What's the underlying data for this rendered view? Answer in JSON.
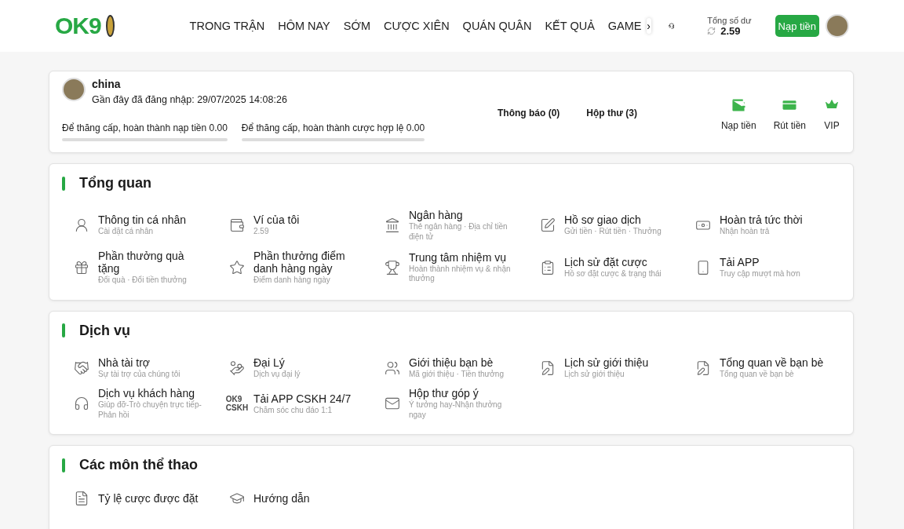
{
  "header": {
    "brand": "OK9",
    "nav": [
      {
        "label": "TRONG TRẬN"
      },
      {
        "label": "HÔM NAY"
      },
      {
        "label": "SỚM"
      },
      {
        "label": "CƯỢC XIÊN"
      },
      {
        "label": "QUÁN QUÂN"
      },
      {
        "label": "KẾT QUẢ"
      },
      {
        "label": "GAME"
      }
    ],
    "nav_more": "›",
    "balance_label": "Tổng số dư",
    "balance": "2.59",
    "deposit_button": "Nạp tiền"
  },
  "profile": {
    "name": "china",
    "last_login": "Gần đây đã đăng nhập: 29/07/2025 14:08:26",
    "progress": [
      {
        "label": "Để thăng cấp, hoàn thành nạp tiền 0.00",
        "level": 0
      },
      {
        "label": "Để thăng cấp, hoàn thành cược hợp lệ 0.00",
        "level": 0
      }
    ],
    "links": [
      "Thông báo (0)",
      "Hộp thư (3)"
    ],
    "actions": [
      "Nạp tiền",
      "Rút tiền",
      "VIP"
    ]
  },
  "sections": [
    {
      "title": "Tổng quan",
      "items": [
        {
          "kind": "icon",
          "title": "Thông tin cá nhân",
          "subtitle": "Cài đặt cá nhân"
        },
        {
          "kind": "icon",
          "title": "Ví của tôi",
          "subtitle": "2.59"
        },
        {
          "kind": "icon",
          "title": "Ngân hàng",
          "subtitle": "Thẻ ngân hàng · Địa chỉ tiền điện tử"
        },
        {
          "kind": "icon",
          "title": "Hồ sơ giao dịch",
          "subtitle": "Gửi tiền · Rút tiền · Thưởng"
        },
        {
          "kind": "icon",
          "title": "Hoàn trả tức thời",
          "subtitle": "Nhận hoàn trả"
        },
        {
          "kind": "icon",
          "title": "Phần thưởng quà tặng",
          "subtitle": "Đổi quà · Đổi tiền thưởng"
        },
        {
          "kind": "icon",
          "title": "Phần thưởng điểm danh hàng ngày",
          "subtitle": "Điểm danh hàng ngày"
        },
        {
          "kind": "icon",
          "title": "Trung tâm nhiệm vụ",
          "subtitle": "Hoàn thành nhiệm vụ & nhận thưởng"
        },
        {
          "kind": "icon",
          "title": "Lịch sử đặt cược",
          "subtitle": "Hồ sơ đặt cược & trạng thái"
        },
        {
          "kind": "icon",
          "title": "Tải APP",
          "subtitle": "Truy cập mượt mà hơn"
        }
      ]
    },
    {
      "title": "Dịch vụ",
      "items": [
        {
          "kind": "icon",
          "title": "Nhà tài trợ",
          "subtitle": "Sự tài trợ của chúng tôi"
        },
        {
          "kind": "icon",
          "title": "Đại Lý",
          "subtitle": "Dịch vụ đại lý"
        },
        {
          "kind": "icon",
          "title": "Giới thiệu bạn bè",
          "subtitle": "Mã giới thiệu · Tiền thưởng"
        },
        {
          "kind": "icon",
          "title": "Lịch sử giới thiệu",
          "subtitle": "Lịch sử giới thiệu"
        },
        {
          "kind": "icon",
          "title": "Tổng quan về bạn bè",
          "subtitle": "Tổng quan về bạn bè"
        },
        {
          "kind": "icon",
          "title": "Dịch vụ khách hàng",
          "subtitle": "Giúp đỡ-Trò chuyện trực tiếp-Phản hồi"
        },
        {
          "kind": "text-logo",
          "logo_lines": [
            "OK9",
            "CSKH"
          ],
          "title": "Tải APP CSKH 24/7",
          "subtitle": "Chăm sóc chu đáo 1:1"
        },
        {
          "kind": "icon",
          "title": "Hộp thư góp ý",
          "subtitle": "Ý tưởng hay-Nhận thưởng ngay"
        }
      ]
    },
    {
      "title": "Các môn thể thao",
      "items": [
        {
          "kind": "icon",
          "title": "Tỷ lệ cược được đặt"
        },
        {
          "kind": "icon",
          "title": "Hướng dẫn"
        }
      ]
    }
  ]
}
